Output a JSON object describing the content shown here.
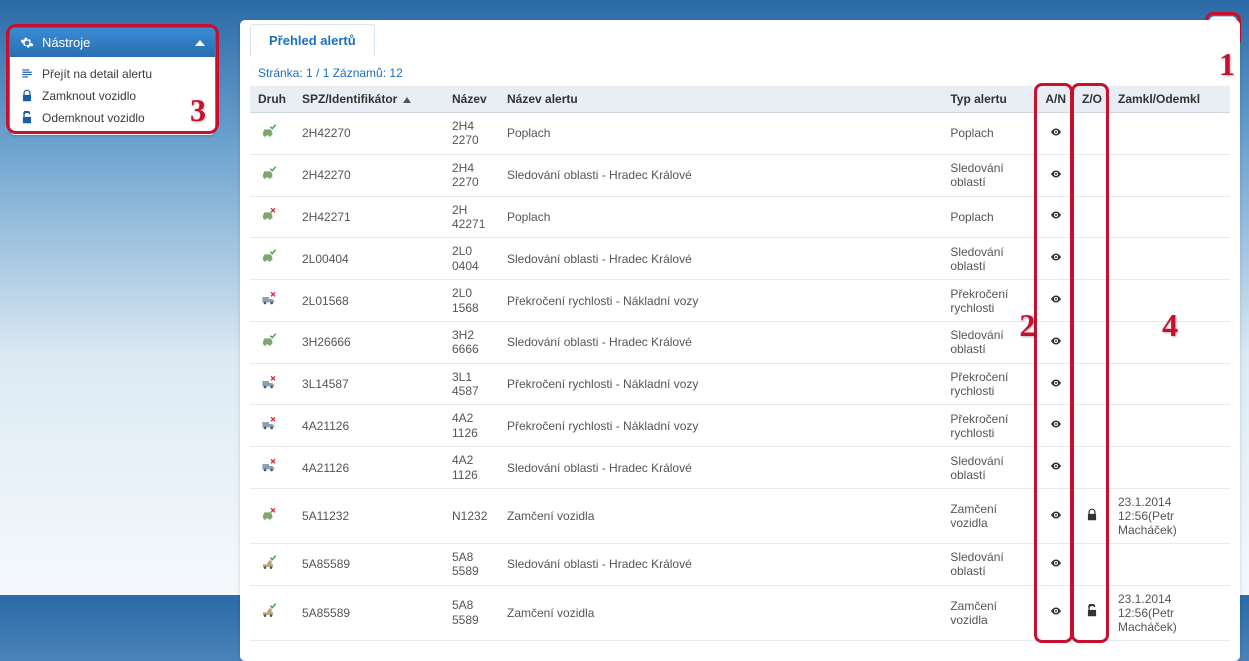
{
  "sidebar": {
    "title": "Nástroje",
    "items": [
      {
        "label": "Přejít na detail alertu",
        "icon": "detail"
      },
      {
        "label": "Zamknout vozidlo",
        "icon": "lock"
      },
      {
        "label": "Odemknout vozidlo",
        "icon": "unlock"
      }
    ]
  },
  "annotations": {
    "n1": "1",
    "n2": "2",
    "n3": "3",
    "n4": "4"
  },
  "main": {
    "tab_label": "Přehled alertů",
    "pager": "Stránka: 1 / 1  Záznamů: 12",
    "columns": {
      "druh": "Druh",
      "spz": "SPZ/Identifikátor",
      "nazev": "Název",
      "nazev_alertu": "Název alertu",
      "typ_alertu": "Typ alertu",
      "an": "A/N",
      "zo": "Z/O",
      "zamkl": "Zamkl/Odemkl"
    },
    "rows": [
      {
        "druh": "car-ok",
        "spz": "2H42270",
        "nazev_l1": "2H4",
        "nazev_l2": "2270",
        "nazev_alertu": "Poplach",
        "typ": "Poplach",
        "an": "eye",
        "zo": "",
        "lock": ""
      },
      {
        "druh": "car-ok",
        "spz": "2H42270",
        "nazev_l1": "2H4",
        "nazev_l2": "2270",
        "nazev_alertu": "Sledování oblasti - Hradec Králové",
        "typ": "Sledování oblastí",
        "an": "eye",
        "zo": "",
        "lock": ""
      },
      {
        "druh": "car-x",
        "spz": "2H42271",
        "nazev_l1": "2H",
        "nazev_l2": "42271",
        "nazev_alertu": "Poplach",
        "typ": "Poplach",
        "an": "eye",
        "zo": "",
        "lock": ""
      },
      {
        "druh": "car-ok",
        "spz": "2L00404",
        "nazev_l1": "2L0",
        "nazev_l2": "0404",
        "nazev_alertu": "Sledování oblasti - Hradec Králové",
        "typ": "Sledování oblastí",
        "an": "eye",
        "zo": "",
        "lock": ""
      },
      {
        "druh": "truck-x",
        "spz": "2L01568",
        "nazev_l1": "2L0",
        "nazev_l2": "1568",
        "nazev_alertu": "Překročení rychlosti - Nákladní vozy",
        "typ": "Překročení rychlosti",
        "an": "eye",
        "zo": "",
        "lock": ""
      },
      {
        "druh": "car-ok",
        "spz": "3H26666",
        "nazev_l1": "3H2",
        "nazev_l2": "6666",
        "nazev_alertu": "Sledování oblasti - Hradec Králové",
        "typ": "Sledování oblastí",
        "an": "eye",
        "zo": "",
        "lock": ""
      },
      {
        "druh": "truck-x",
        "spz": "3L14587",
        "nazev_l1": "3L1",
        "nazev_l2": "4587",
        "nazev_alertu": "Překročení rychlosti - Nákladní vozy",
        "typ": "Překročení rychlosti",
        "an": "eye",
        "zo": "",
        "lock": ""
      },
      {
        "druh": "truck-x",
        "spz": "4A21126",
        "nazev_l1": "4A2",
        "nazev_l2": "1126",
        "nazev_alertu": "Překročení rychlosti - Nákladní vozy",
        "typ": "Překročení rychlosti",
        "an": "eye",
        "zo": "",
        "lock": ""
      },
      {
        "druh": "truck-x",
        "spz": "4A21126",
        "nazev_l1": "4A2",
        "nazev_l2": "1126",
        "nazev_alertu": "Sledování oblasti - Hradec Králové",
        "typ": "Sledování oblastí",
        "an": "eye",
        "zo": "",
        "lock": ""
      },
      {
        "druh": "car-x",
        "spz": "5A11232",
        "nazev_l1": "N1232",
        "nazev_l2": "",
        "nazev_alertu": "Zamčení vozidla",
        "typ": "Zamčení vozidla",
        "an": "eye",
        "zo": "lock",
        "lock": "23.1.2014 12:56(Petr Macháček)"
      },
      {
        "druh": "machine-ok",
        "spz": "5A85589",
        "nazev_l1": "5A8",
        "nazev_l2": "5589",
        "nazev_alertu": "Sledování oblasti - Hradec Králové",
        "typ": "Sledování oblastí",
        "an": "eye",
        "zo": "",
        "lock": ""
      },
      {
        "druh": "machine-ok",
        "spz": "5A85589",
        "nazev_l1": "5A8",
        "nazev_l2": "5589",
        "nazev_alertu": "Zamčení vozidla",
        "typ": "Zamčení vozidla",
        "an": "eye",
        "zo": "unlock",
        "lock": "23.1.2014 12:56(Petr Macháček)"
      }
    ]
  }
}
